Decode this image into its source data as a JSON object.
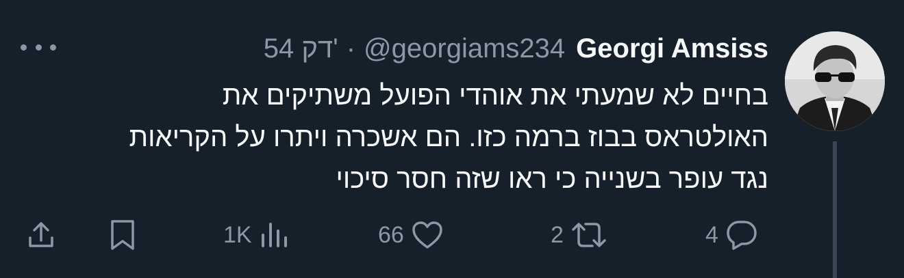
{
  "tweet": {
    "author_name": "Georgi Amsiss",
    "handle": "@georgiams234",
    "separator": "·",
    "time": "54 דק'",
    "text_lines": [
      "בחיים לא שמעתי את אוהדי הפועל משתיקים את",
      "האולטראס בבוז ברמה כזו. הם אשכרה ויתרו על הקריאות",
      "נגד עופר בשנייה כי ראו שזה חסר סיכוי"
    ]
  },
  "actions": {
    "replies": "4",
    "retweets": "2",
    "likes": "66",
    "views": "1K"
  },
  "icons": {
    "more": "more-horizontal-icon",
    "reply": "reply-bubble-icon",
    "retweet": "retweet-icon",
    "like": "heart-icon",
    "views": "bar-chart-icon",
    "bookmark": "bookmark-icon",
    "share": "share-icon"
  },
  "colors": {
    "background": "#15202b",
    "text": "#f7f9f9",
    "muted": "#8b98a5",
    "thread_line": "#3a4752"
  }
}
